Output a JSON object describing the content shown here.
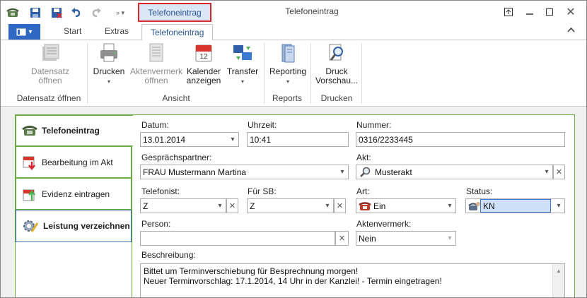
{
  "window": {
    "title": "Telefoneintrag",
    "context_tab": "Telefoneintrag"
  },
  "tabs": {
    "start": "Start",
    "extras": "Extras",
    "telefoneintrag": "Telefoneintrag"
  },
  "ribbon": {
    "datensatz_oeffnen": {
      "line1": "Datensatz",
      "line2": "öffnen"
    },
    "drucken": "Drucken",
    "aktenvermerk_oeffnen": {
      "line1": "Aktenvermerk",
      "line2": "öffnen"
    },
    "kalender_anzeigen": {
      "line1": "Kalender",
      "line2": "anzeigen"
    },
    "transfer": "Transfer",
    "reporting": "Reporting",
    "druck_vorschau": {
      "line1": "Druck",
      "line2": "Vorschau..."
    },
    "groups": {
      "datensatz": "Datensatz öffnen",
      "ansicht": "Ansicht",
      "reports": "Reports",
      "drucken": "Drucken"
    },
    "calendar_day": "12"
  },
  "sidebar": {
    "items": [
      {
        "label": "Telefoneintrag"
      },
      {
        "label": "Bearbeitung im Akt"
      },
      {
        "label": "Evidenz eintragen"
      },
      {
        "label": "Leistung verzeichnen"
      }
    ]
  },
  "form": {
    "datum": {
      "label": "Datum:",
      "value": "13.01.2014"
    },
    "uhrzeit": {
      "label": "Uhrzeit:",
      "value": "10:41"
    },
    "nummer": {
      "label": "Nummer:",
      "value": "0316/2233445"
    },
    "gespraechspartner": {
      "label": "Gesprächspartner:",
      "value": "FRAU Mustermann Martina"
    },
    "akt": {
      "label": "Akt:",
      "value": "Musterakt"
    },
    "telefonist": {
      "label": "Telefonist:",
      "value": "Z"
    },
    "fuer_sb": {
      "label": "Für SB:",
      "value": "Z"
    },
    "art": {
      "label": "Art:",
      "value": "Ein"
    },
    "status": {
      "label": "Status:",
      "value": "KN"
    },
    "person": {
      "label": "Person:",
      "value": ""
    },
    "aktenvermerk": {
      "label": "Aktenvermerk:",
      "value": "Nein"
    },
    "beschreibung": {
      "label": "Beschreibung:",
      "line1": "Bittet um Terminverschiebung für Besprechnung morgen!",
      "line2": "Neuer Terminvorschlag: 17.1.2014, 14 Uhr in der Kanzlei! - Termin eingetragen!"
    }
  },
  "colors": {
    "accent": "#2b579a",
    "highlight_border": "#d9262e",
    "panel_border": "#6aab45",
    "file_button": "#2f68c3"
  }
}
